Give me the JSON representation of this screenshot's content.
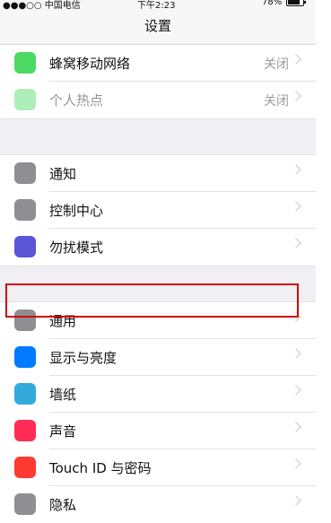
{
  "status_bar": {
    "carrier": "●●●○○ 中国电信",
    "time": "下午2:23",
    "battery": "78%"
  },
  "nav": {
    "title": "设置"
  },
  "groups": [
    [
      {
        "label": "蜂窝移动网络",
        "value": "关闭",
        "icon": "antenna-icon",
        "color": "#4cd964"
      },
      {
        "label": "个人热点",
        "value": "关闭",
        "icon": "hotspot-icon",
        "color": "#4cd964",
        "disabled": true
      }
    ],
    [
      {
        "label": "通知",
        "value": "",
        "icon": "notifications-icon",
        "color": "#8e8e93"
      },
      {
        "label": "控制中心",
        "value": "",
        "icon": "control-center-icon",
        "color": "#8e8e93"
      },
      {
        "label": "勿扰模式",
        "value": "",
        "icon": "moon-icon",
        "color": "#5856d6"
      }
    ],
    [
      {
        "label": "通用",
        "value": "",
        "icon": "gear-icon",
        "color": "#8e8e93"
      },
      {
        "label": "显示与亮度",
        "value": "",
        "icon": "display-brightness-icon",
        "color": "#007aff"
      },
      {
        "label": "墙纸",
        "value": "",
        "icon": "wallpaper-icon",
        "color": "#34aadc"
      },
      {
        "label": "声音",
        "value": "",
        "icon": "speaker-icon",
        "color": "#ff2d55"
      },
      {
        "label": "Touch ID 与密码",
        "value": "",
        "icon": "fingerprint-icon",
        "color": "#ff3b30"
      },
      {
        "label": "隐私",
        "value": "",
        "icon": "hand-icon",
        "color": "#8e8e93"
      }
    ]
  ]
}
